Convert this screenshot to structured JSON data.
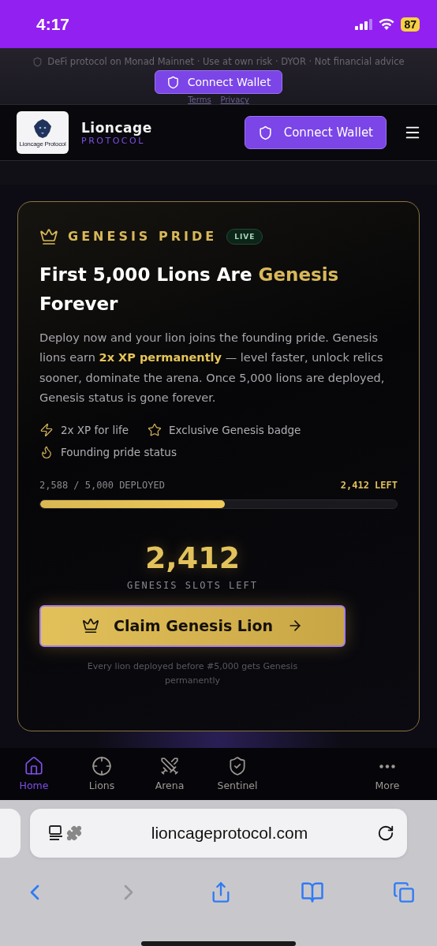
{
  "status_bar": {
    "time": "4:17",
    "battery": "87"
  },
  "disclaimer": {
    "text": "DeFi protocol on Monad Mainnet · Use at own risk · DYOR · Not financial advice",
    "links": [
      "Terms",
      "Privacy"
    ]
  },
  "floating_button": {
    "label": "Connect Wallet"
  },
  "header": {
    "logo_caption": "Lioncage Protocol",
    "brand": "Lioncage",
    "brand_sub": "PROTOCOL",
    "connect_button": "Connect Wallet"
  },
  "card": {
    "eyebrow": "GENESIS PRIDE",
    "badge": "LIVE",
    "title": "First 5,000 Lions Are ",
    "title_accent": "Genesis",
    "title_end": "Forever",
    "body": "Deploy now and your lion joins the founding pride. Genesis lions earn **2x XP permanently** — level faster, unlock relics sooner, dominate the arena. Once 5,000 lions are deployed, Genesis status is gone forever.",
    "perks": [
      {
        "kind": "bolt",
        "label": "2x XP for life"
      },
      {
        "kind": "star",
        "label": "Exclusive Genesis badge"
      },
      {
        "kind": "flame",
        "label": "Founding pride status"
      }
    ],
    "progress": {
      "deployed": "2,588 / 5,000 DEPLOYED",
      "left": "2,412 LEFT",
      "level": 0.5176
    },
    "big_number": "2,412",
    "big_caption": "GENESIS SLOTS LEFT",
    "cta": "Claim Genesis Lion",
    "footnote": "Every lion deployed before #5,000 gets Genesis permanently"
  },
  "bottom_nav": [
    {
      "kind": "home",
      "label": "Home",
      "selected": true
    },
    {
      "kind": "target",
      "label": "Lions",
      "selected": false
    },
    {
      "kind": "swords",
      "label": "Arena",
      "selected": false
    },
    {
      "kind": "shield",
      "label": "Sentinel",
      "selected": false
    },
    {
      "kind": "more",
      "label": "More",
      "selected": false
    }
  ],
  "browser": {
    "url": "lioncageprotocol.com"
  }
}
